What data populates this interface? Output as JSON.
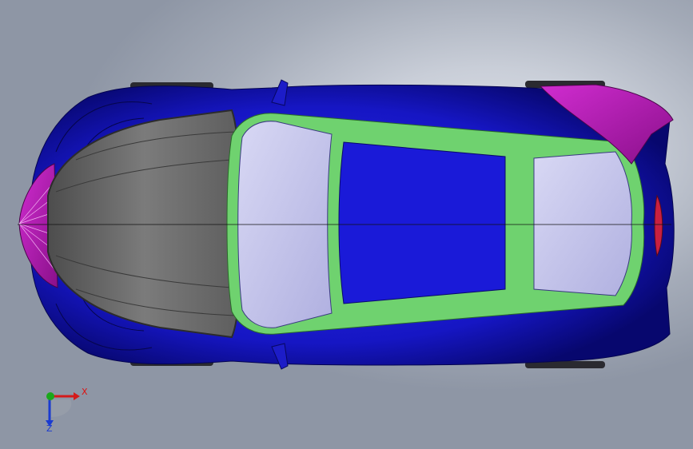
{
  "viewport": {
    "background": "#c9ced8",
    "model": {
      "description_colors": {
        "body": "#1a1ad2",
        "body_dark": "#0a0a8c",
        "hood": "#6f6f6f",
        "windshield": "#c8c8ec",
        "roof_trim": "#6fd26f",
        "accent": "#c21fc2",
        "light": "#c82040"
      }
    },
    "triad": {
      "x_label": "X",
      "z_label": "Z",
      "x_color": "#d41a1a",
      "z_color": "#1a3bd1",
      "origin_color": "#1aa81a"
    }
  }
}
